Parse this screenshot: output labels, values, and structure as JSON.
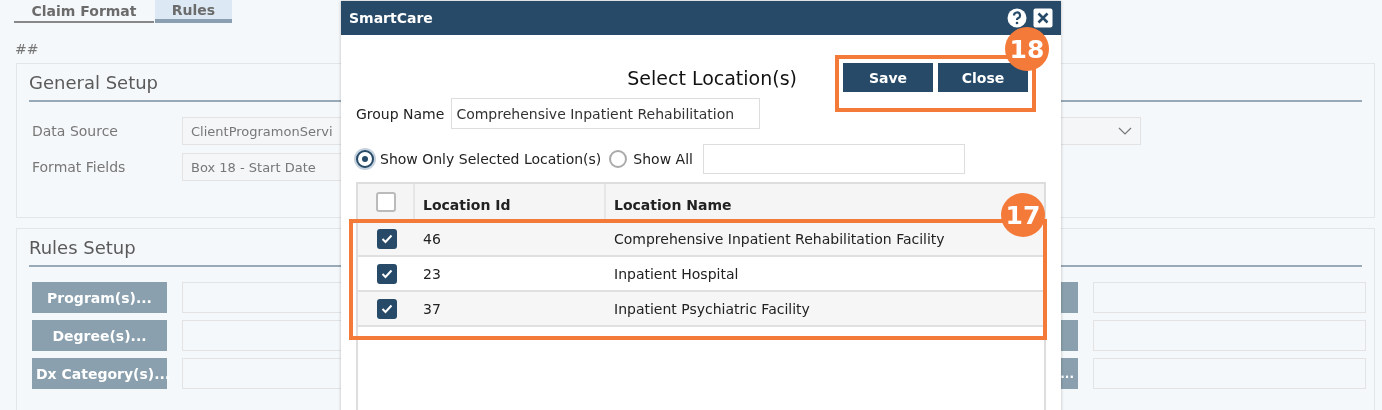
{
  "tabs": [
    {
      "label": "Claim Format",
      "selected": false
    },
    {
      "label": "Rules",
      "selected": true
    }
  ],
  "page_marker": "##",
  "general_setup": {
    "title": "General Setup",
    "fields": [
      {
        "label": "Data Source",
        "value": "ClientProgramonServi",
        "kind": "dropdown"
      },
      {
        "label": "Format Fields",
        "value": "Box 18 - Start Date",
        "kind": "text"
      }
    ]
  },
  "rules_setup": {
    "title": "Rules Setup",
    "rows": [
      {
        "button": "Program(s)...",
        "right_button": ""
      },
      {
        "button": "Degree(s)...",
        "right_button": ""
      },
      {
        "button": "Dx Category(s)...",
        "right_button": "..."
      }
    ]
  },
  "dialog": {
    "title": "SmartCare",
    "heading": "Select Location(s)",
    "buttons": [
      "Save",
      "Close"
    ],
    "group_name_label": "Group Name",
    "group_name_value": "Comprehensive Inpatient Rehabilitation",
    "filters": [
      {
        "label": "Show Only Selected Location(s)",
        "selected": true
      },
      {
        "label": "Show All",
        "selected": false
      }
    ],
    "table": {
      "select_all_checked": false,
      "columns": [
        "Location Id",
        "Location Name"
      ],
      "rows": [
        {
          "checked": true,
          "id": "46",
          "name": "Comprehensive Inpatient Rehabilitation Facility"
        },
        {
          "checked": true,
          "id": "23",
          "name": "Inpatient Hospital"
        },
        {
          "checked": true,
          "id": "37",
          "name": "Inpatient Psychiatric Facility"
        }
      ]
    },
    "buttons_callout": "18",
    "rows_callout": "17"
  }
}
